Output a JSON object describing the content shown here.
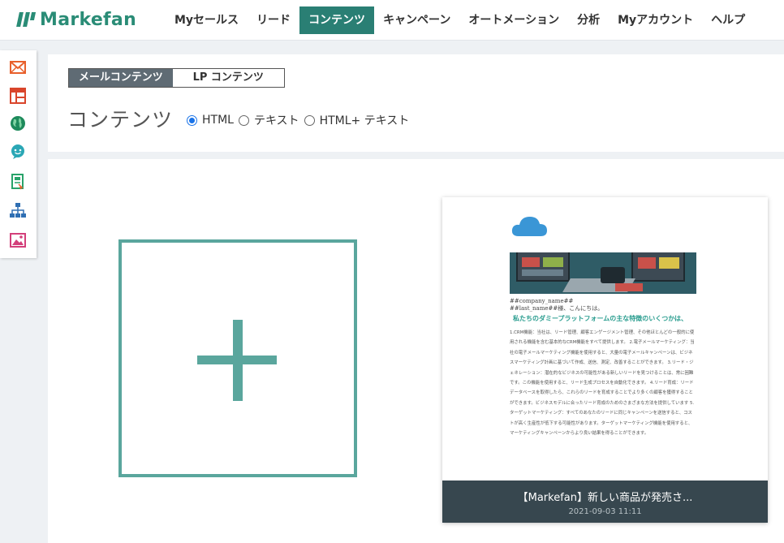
{
  "brand": {
    "name": "Markefan",
    "color": "#2a8c76"
  },
  "nav": {
    "items": [
      {
        "label": "Myセールス"
      },
      {
        "label": "リード"
      },
      {
        "label": "コンテンツ",
        "active": true
      },
      {
        "label": "キャンペーン"
      },
      {
        "label": "オートメーション"
      },
      {
        "label": "分析"
      },
      {
        "label": "Myアカウント"
      },
      {
        "label": "ヘルプ"
      }
    ],
    "active_color": "#2a7f74"
  },
  "rail": {
    "icons": [
      "mail-icon",
      "layout-icon",
      "globe-icon",
      "chat-icon",
      "landing-page-icon",
      "sitemap-icon",
      "image-icon"
    ]
  },
  "content_tabs": {
    "mail": "メールコンテンツ",
    "lp": "LP コンテンツ"
  },
  "page_title": "コンテンツ",
  "format_options": {
    "html": "HTML",
    "text": "テキスト",
    "html_text": "HTML+ テキスト",
    "selected": "HTML"
  },
  "add_tile": {
    "icon": "plus-icon",
    "color": "#5aa69d"
  },
  "card": {
    "preview": {
      "company_line": "##company_name##",
      "greeting": "##last_name##様、こんにちは。",
      "heading": "私たちのダミープラットフォームの主な特徴のいくつかは、",
      "body": "1.CRM機能：当社は、リード管理、顧客エンゲージメント管理、その他ほとんどの一般的に使用される機能を含む基本的なCRM機能をすべて提供します。 2.電子メールマーケティング：当社の電子メールマーケティング機能を使用すると、大量の電子メールキャンペーンは、ビジネスマーケティング計画に基づいて作成、送信、測定、改善することができます。 3.リード・ジェネレーション：潜在的なビジネスの可能性がある新しいリードを見つけることは、常に困難です。この機能を使用すると、リード生成プロセスを自動化できます。 4.リード育成：リードデータベースを取得したら、これらのリードを育成することでより多くの顧客を獲得することができます。ビジネスモデルに合ったリード育成のためのさまざまな方法を提供しています 5.ターゲットマーケティング：すべてのあなたのリードに同じキャンペーンを送信すると、コストが高く生産性が低下する可能性があります。ターゲットマーケティング機能を使用すると、マーケティングキャンペーンからより良い結果を得ることができます。"
    },
    "title": "【Markefan】新しい商品が発売さ...",
    "date": "2021-09-03 11:11"
  }
}
